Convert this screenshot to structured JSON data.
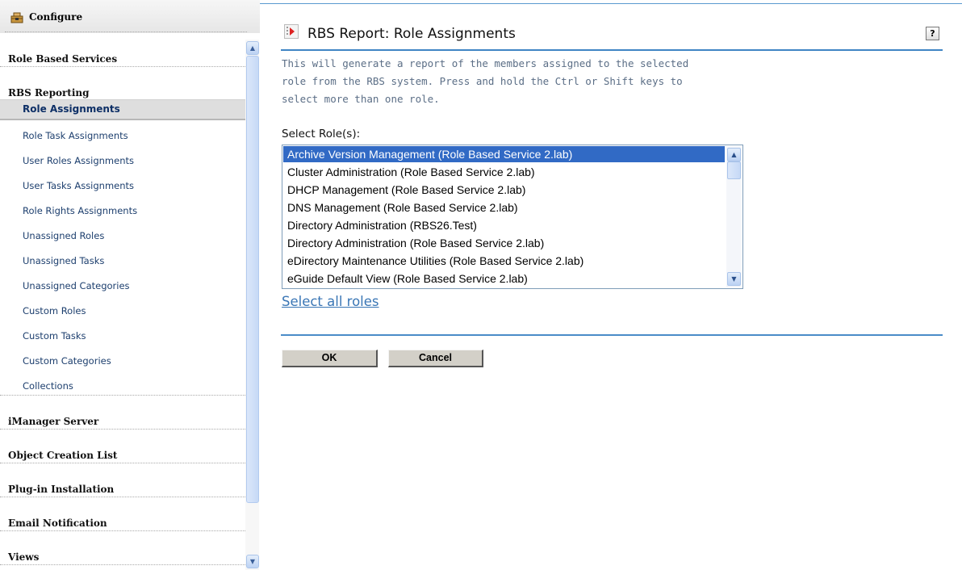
{
  "sidebar": {
    "header_title": "Configure",
    "sections": [
      {
        "label": "Role Based Services"
      },
      {
        "label": "RBS Reporting"
      }
    ],
    "sub_items": [
      {
        "label": "Role Assignments"
      },
      {
        "label": "Role Task Assignments"
      },
      {
        "label": "User Roles Assignments"
      },
      {
        "label": "User Tasks Assignments"
      },
      {
        "label": "Role Rights Assignments"
      },
      {
        "label": "Unassigned Roles"
      },
      {
        "label": "Unassigned Tasks"
      },
      {
        "label": "Unassigned Categories"
      },
      {
        "label": "Custom Roles"
      },
      {
        "label": "Custom Tasks"
      },
      {
        "label": "Custom Categories"
      },
      {
        "label": "Collections"
      }
    ],
    "sections_after": [
      {
        "label": "iManager Server"
      },
      {
        "label": "Object Creation List"
      },
      {
        "label": "Plug-in Installation"
      },
      {
        "label": "Email Notification"
      },
      {
        "label": "Views"
      }
    ],
    "active_item": "Role Assignments"
  },
  "main": {
    "title": "RBS Report: Role Assignments",
    "help_label": "?",
    "description_lines": [
      "This will generate a report of the members assigned to the selected",
      "role from the RBS system. Press and hold the Ctrl or Shift keys to",
      "select more than one role."
    ],
    "select_label": "Select Role(s):",
    "roles": [
      "Archive Version Management (Role Based Service 2.lab)",
      "Cluster Administration (Role Based Service 2.lab)",
      "DHCP Management (Role Based Service 2.lab)",
      "DNS Management (Role Based Service 2.lab)",
      "Directory Administration (RBS26.Test)",
      "Directory Administration (Role Based Service 2.lab)",
      "eDirectory Maintenance Utilities (Role Based Service 2.lab)",
      "eGuide Default View (Role Based Service 2.lab)"
    ],
    "selected_role": "Archive Version Management (Role Based Service 2.lab)",
    "select_all_label": "Select all roles",
    "ok_label": "OK",
    "cancel_label": "Cancel"
  },
  "colors": {
    "accent_rule": "#3f85c4",
    "selection": "#316ac5",
    "link": "#3a76b5"
  }
}
